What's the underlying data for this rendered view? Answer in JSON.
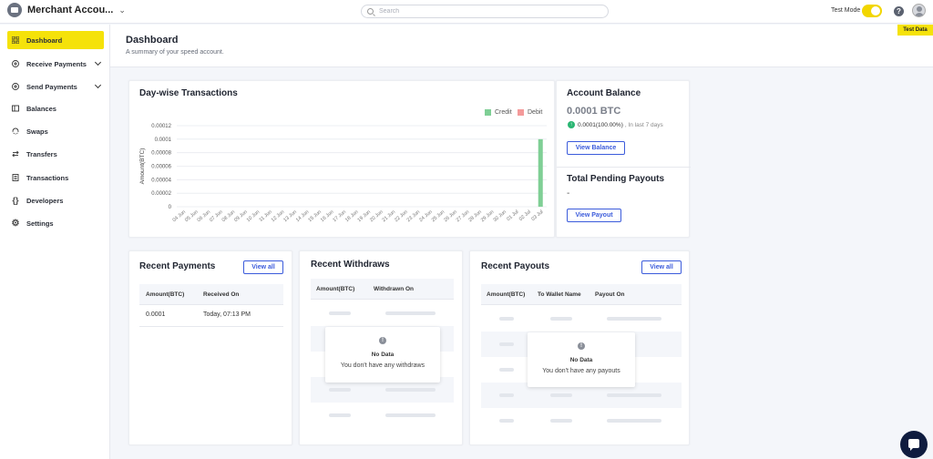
{
  "header": {
    "account_name": "Merchant Accou...",
    "search_placeholder": "Search",
    "test_mode_label": "Test Mode",
    "test_mode_on": true,
    "test_data_badge": "Test Data"
  },
  "sidebar": {
    "items": [
      {
        "label": "Dashboard",
        "icon": "grid-icon",
        "active": true
      },
      {
        "label": "Receive Payments",
        "icon": "plus-circle-icon",
        "expandable": true
      },
      {
        "label": "Send Payments",
        "icon": "plus-circle-icon",
        "expandable": true
      },
      {
        "label": "Balances",
        "icon": "wallet-icon"
      },
      {
        "label": "Swaps",
        "icon": "swap-icon"
      },
      {
        "label": "Transfers",
        "icon": "transfer-arrows-icon"
      },
      {
        "label": "Transactions",
        "icon": "receipt-icon"
      },
      {
        "label": "Developers",
        "icon": "code-braces-icon"
      },
      {
        "label": "Settings",
        "icon": "gear-icon"
      }
    ]
  },
  "page": {
    "title": "Dashboard",
    "subtitle": "A summary of your speed account."
  },
  "transactions_card": {
    "title": "Day-wise Transactions",
    "legend_credit": "Credit",
    "legend_debit": "Debit"
  },
  "chart_data": {
    "type": "bar",
    "title": "Day-wise Transactions",
    "ylabel": "Amount(BTC)",
    "xlabel": "",
    "ylim": [
      0,
      0.00012
    ],
    "yticks": [
      "0.00012",
      "0.0001",
      "0.00008",
      "0.00006",
      "0.00004",
      "0.00002",
      "0"
    ],
    "categories": [
      "04 Jun",
      "05 Jun",
      "06 Jun",
      "07 Jun",
      "08 Jun",
      "09 Jun",
      "10 Jun",
      "11 Jun",
      "12 Jun",
      "13 Jun",
      "14 Jun",
      "15 Jun",
      "16 Jun",
      "17 Jun",
      "18 Jun",
      "19 Jun",
      "20 Jun",
      "21 Jun",
      "22 Jun",
      "23 Jun",
      "24 Jun",
      "25 Jun",
      "26 Jun",
      "27 Jun",
      "28 Jun",
      "29 Jun",
      "30 Jun",
      "01 Jul",
      "02 Jul",
      "03 Jul"
    ],
    "series": [
      {
        "name": "Credit",
        "color": "#7fcf95",
        "values": [
          0,
          0,
          0,
          0,
          0,
          0,
          0,
          0,
          0,
          0,
          0,
          0,
          0,
          0,
          0,
          0,
          0,
          0,
          0,
          0,
          0,
          0,
          0,
          0,
          0,
          0,
          0,
          0,
          0,
          0.0001
        ]
      },
      {
        "name": "Debit",
        "color": "#f49a9a",
        "values": [
          0,
          0,
          0,
          0,
          0,
          0,
          0,
          0,
          0,
          0,
          0,
          0,
          0,
          0,
          0,
          0,
          0,
          0,
          0,
          0,
          0,
          0,
          0,
          0,
          0,
          0,
          0,
          0,
          0,
          0
        ]
      }
    ],
    "grid": true,
    "legend_position": "top-right"
  },
  "account_balance": {
    "title": "Account Balance",
    "value": "0.0001 BTC",
    "trend": "0.0001(100.00%)",
    "trend_suffix": ", In last 7 days",
    "button": "View Balance"
  },
  "pending_payouts": {
    "title": "Total Pending Payouts",
    "value": "-",
    "button": "View Payout"
  },
  "recent_payments": {
    "title": "Recent Payments",
    "view_all": "View all",
    "columns": [
      "Amount(BTC)",
      "Received On"
    ],
    "rows": [
      [
        "0.0001",
        "Today, 07:13 PM"
      ]
    ]
  },
  "recent_withdraws": {
    "title": "Recent Withdraws",
    "columns": [
      "Amount(BTC)",
      "Withdrawn On"
    ],
    "no_data_title": "No Data",
    "no_data_message": "You don't have any withdraws"
  },
  "recent_payouts": {
    "title": "Recent Payouts",
    "view_all": "View all",
    "columns": [
      "Amount(BTC)",
      "To Wallet Name",
      "Payout On"
    ],
    "no_data_title": "No Data",
    "no_data_message": "You don't have any payouts"
  }
}
